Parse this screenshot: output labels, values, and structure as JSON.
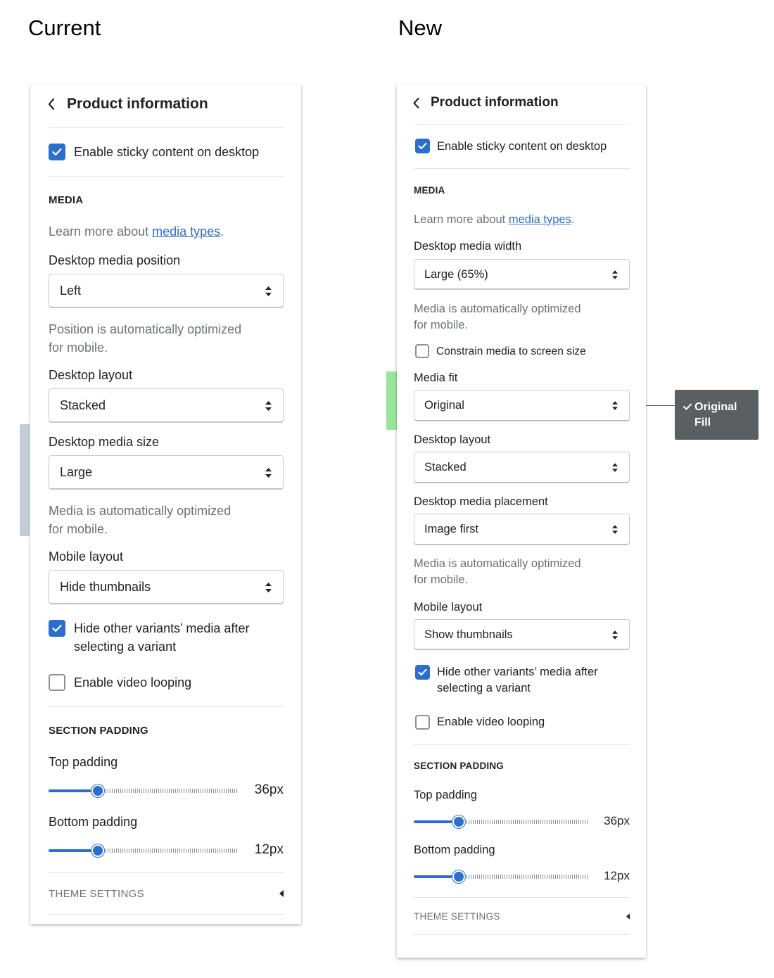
{
  "labels": {
    "current": "Current",
    "new": "New"
  },
  "current": {
    "header": "Product information",
    "sticky": "Enable sticky content on desktop",
    "media_heading": "MEDIA",
    "learn_prefix": "Learn more about ",
    "learn_link": "media types",
    "learn_suffix": ".",
    "position_label": "Desktop media position",
    "position_value": "Left",
    "position_help_1": "Position is automatically optimized",
    "position_help_2": "for mobile.",
    "layout_label": "Desktop layout",
    "layout_value": "Stacked",
    "size_label": "Desktop media size",
    "size_value": "Large",
    "size_help_1": "Media is automatically optimized",
    "size_help_2": "for mobile.",
    "mobile_label": "Mobile layout",
    "mobile_value": "Hide thumbnails",
    "hide_variants_1": "Hide other variants’ media after",
    "hide_variants_2": "selecting a variant",
    "video_loop": "Enable video looping",
    "padding_heading": "SECTION PADDING",
    "top_label": "Top padding",
    "top_value": "36px",
    "bottom_label": "Bottom padding",
    "bottom_value": "12px",
    "theme_settings": "THEME SETTINGS"
  },
  "new": {
    "header": "Product information",
    "sticky": "Enable sticky content on desktop",
    "media_heading": "MEDIA",
    "learn_prefix": "Learn more about ",
    "learn_link": "media types",
    "learn_suffix": ".",
    "width_label": "Desktop media width",
    "width_value": "Large (65%)",
    "width_help_1": "Media is automatically optimized",
    "width_help_2": "for mobile.",
    "constrain": "Constrain media to screen size",
    "fit_label": "Media fit",
    "fit_value": "Original",
    "layout_label": "Desktop layout",
    "layout_value": "Stacked",
    "placement_label": "Desktop media placement",
    "placement_value": "Image first",
    "placement_help_1": "Media is automatically optimized",
    "placement_help_2": "for mobile.",
    "mobile_label": "Mobile layout",
    "mobile_value": "Show thumbnails",
    "hide_variants_1": "Hide other variants’ media after",
    "hide_variants_2": "selecting a variant",
    "video_loop": "Enable video looping",
    "padding_heading": "SECTION PADDING",
    "top_label": "Top padding",
    "top_value": "36px",
    "bottom_label": "Bottom padding",
    "bottom_value": "12px",
    "theme_settings": "THEME SETTINGS"
  },
  "fit_dropdown": {
    "options": [
      "Original",
      "Fill"
    ],
    "selected": "Original"
  },
  "sliders": {
    "current_top_fraction": 0.26,
    "current_bottom_fraction": 0.26,
    "new_top_fraction": 0.26,
    "new_bottom_fraction": 0.26
  },
  "colors": {
    "accent": "#2c6ecb",
    "tooltip": "#5c5f62",
    "highlight_green": "#98e698",
    "highlight_gray": "#c4ccd4"
  },
  "icons": [
    "chevron-left-icon",
    "checkmark-icon",
    "select-arrows-icon",
    "caret-left-icon"
  ]
}
